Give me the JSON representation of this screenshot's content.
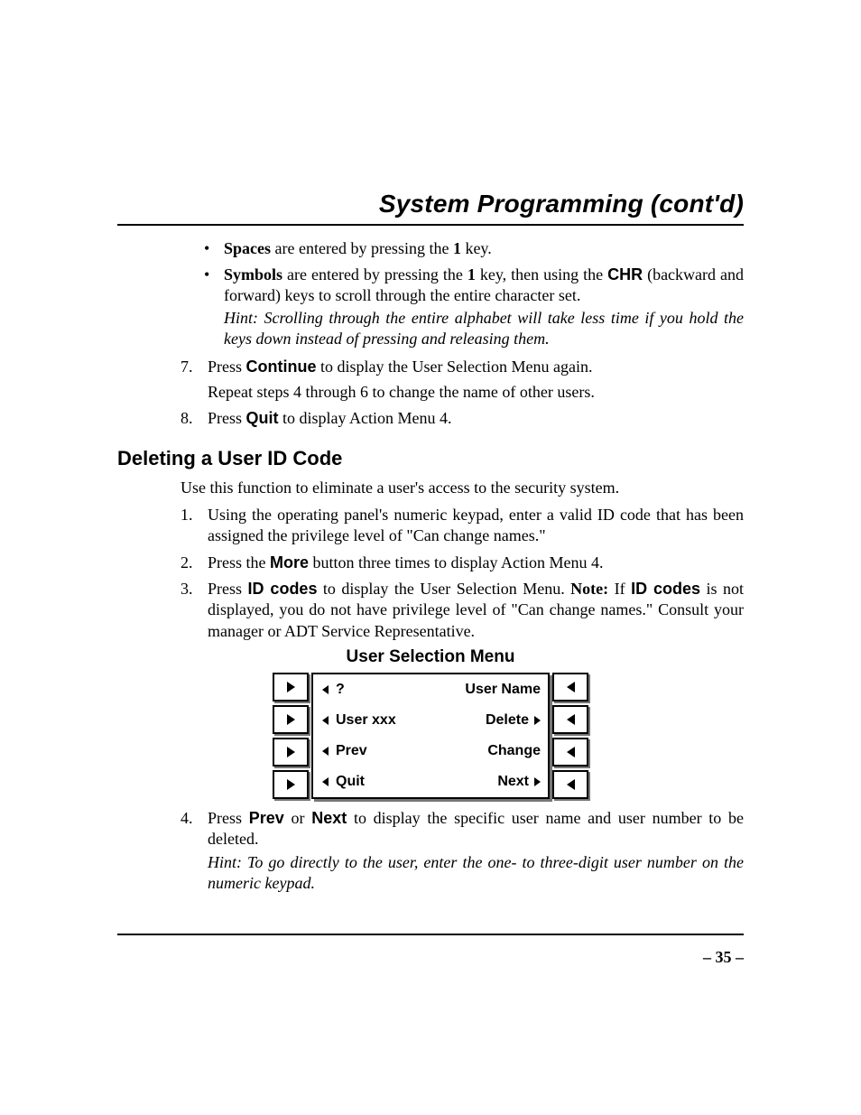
{
  "title": "System Programming (cont'd)",
  "bullets": [
    {
      "lead": "Spaces",
      "rest": " are entered by pressing the ",
      "key": "1",
      "tail": " key."
    },
    {
      "lead": "Symbols",
      "rest": " are entered by pressing the ",
      "key": "1",
      "mid": " key, then using the ",
      "chr": "CHR",
      "tail2": " (backward and forward) keys to scroll through the entire character set.",
      "hint": "Hint: Scrolling through the entire alphabet will take less time if you hold the keys down instead of pressing and releasing them."
    }
  ],
  "steps_a": [
    {
      "n": "7.",
      "pre": "Press ",
      "b": "Continue",
      "post": " to display the User Selection Menu again.",
      "sub": "Repeat steps 4 through 6 to change the name of other users."
    },
    {
      "n": "8.",
      "pre": "Press ",
      "b": "Quit",
      "post": " to display Action Menu 4."
    }
  ],
  "section2": "Deleting a User ID Code",
  "intro2": "Use this function to eliminate a user's access to the security system.",
  "steps_b": [
    {
      "n": "1.",
      "text": "Using the operating panel's numeric keypad, enter a valid ID code that has been assigned the privilege level of \"Can change names.\""
    },
    {
      "n": "2.",
      "pre": "Press the ",
      "b": "More",
      "post": " button three times to display Action Menu 4."
    },
    {
      "n": "3.",
      "pre": "Press ",
      "b": "ID codes",
      "mid": " to display the User Selection Menu. ",
      "notelabel": "Note:",
      "post2": " If ",
      "b2": "ID codes",
      "tail": " is not displayed, you do not have privilege level of \"Can change names.\" Consult your manager or ADT Service Representative."
    }
  ],
  "menu_title": "User Selection Menu",
  "menu_rows": [
    {
      "l": "?",
      "larrow": true,
      "r": "User Name",
      "rarrow": false
    },
    {
      "l": "User xxx",
      "larrow": true,
      "r": "Delete",
      "rarrow": true
    },
    {
      "l": "Prev",
      "larrow": true,
      "r": "Change",
      "rarrow": false
    },
    {
      "l": "Quit",
      "larrow": true,
      "r": "Next",
      "rarrow": true
    }
  ],
  "steps_c": [
    {
      "n": "4.",
      "pre": "Press ",
      "b": "Prev",
      "or": " or ",
      "b2": "Next",
      "post": " to display the specific user name and user number to be deleted.",
      "hint": "Hint: To go directly to the user, enter the one- to three-digit user number on the numeric keypad."
    }
  ],
  "page_number": "– 35 –"
}
